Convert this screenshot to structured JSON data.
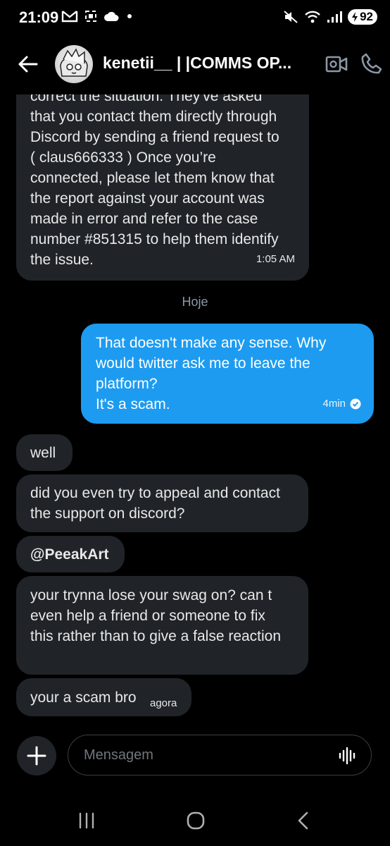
{
  "status_bar": {
    "time": "21:09",
    "battery": "92"
  },
  "header": {
    "contact_name": "kenetii__ | |COMMS OP..."
  },
  "messages": [
    {
      "side": "in",
      "text": "correct the situation. They've asked that you contact them directly through Discord by sending a friend request to ( claus666333 ) Once you’re connected, please let them know that the report against your account was made in error and refer to the case number #851315 to help them identify the issue.",
      "time": "1:05 AM"
    },
    {
      "side": "in",
      "text": "well"
    },
    {
      "side": "in",
      "text": "did you even try to appeal and contact the support on discord?"
    },
    {
      "side": "in",
      "text": "@PeeakArt"
    },
    {
      "side": "in",
      "text": "your trynna lose your swag on? can t even help a friend or someone to fix this rather than to give a false reaction"
    },
    {
      "side": "in",
      "text": "your a scam bro",
      "time": "agora"
    }
  ],
  "day_separator": "Hoje",
  "outgoing": {
    "text": "That doesn't make any sense. Why would twitter ask me to leave the platform?\nIt's a scam.",
    "time": "4min"
  },
  "composer": {
    "placeholder": "Mensagem"
  },
  "colors": {
    "outgoing_bubble": "#1d9bf0",
    "incoming_bubble": "#202327"
  }
}
